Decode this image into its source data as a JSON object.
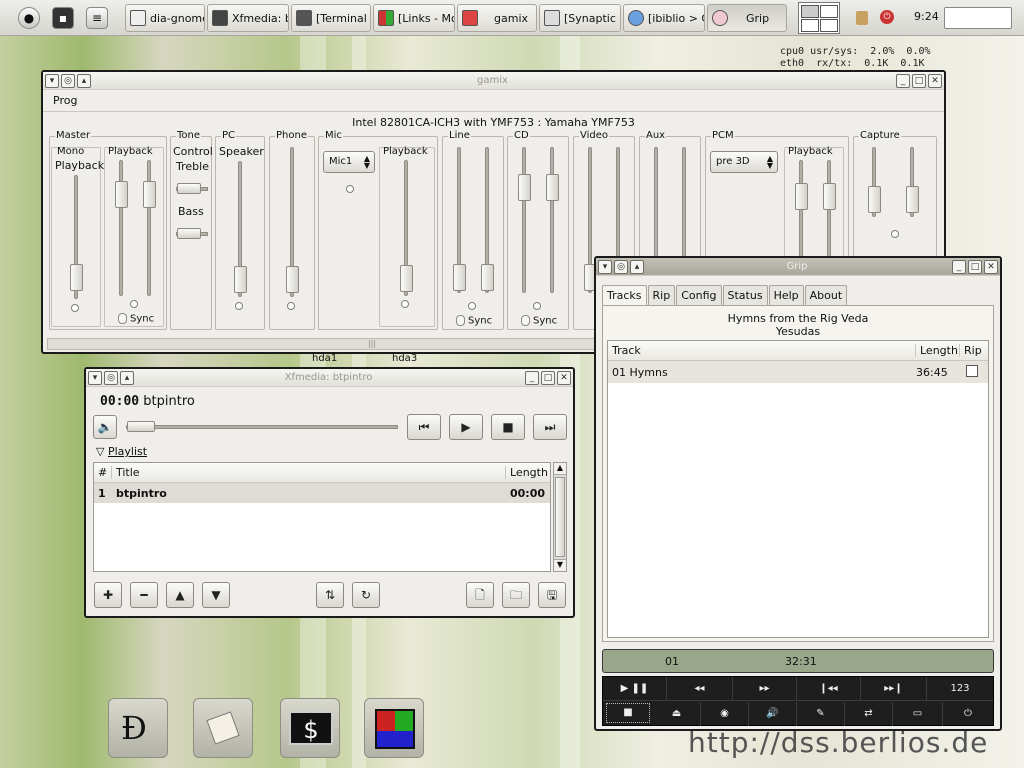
{
  "taskbar": {
    "tasks": [
      "dia-gnome (",
      "Xfmedia: btp",
      "[Terminal - d",
      "[Links - Mon",
      "gamix",
      "[Synaptic Pa",
      "[ibiblio > Co",
      "Grip"
    ],
    "clock": "9:24"
  },
  "sysmon": {
    "line1": "cpu0 usr/sys:  2.0%  0.0%",
    "line2": "eth0  rx/tx:  0.1K  0.1K"
  },
  "desktop_labels": [
    "hda1",
    "hda3"
  ],
  "watermark": "http://dss.berlios.de",
  "gamix": {
    "title": "gamix",
    "menu": "Prog",
    "card": "Intel 82801CA-ICH3 with YMF753 : Yamaha YMF753",
    "groups": {
      "master": "Master",
      "mono": "Mono",
      "mono_play": "Playback",
      "playback": "Playback",
      "sync": "Sync",
      "tone": "Tone",
      "control": "Control",
      "treble": "Treble",
      "bass": "Bass",
      "pc": "PC",
      "speaker": "Speaker",
      "phone": "Phone",
      "mic": "Mic",
      "mic_combo": "Mic1",
      "line": "Line",
      "cd": "CD",
      "video": "Video",
      "aux": "Aux",
      "pcm": "PCM",
      "pcm_combo": "pre 3D",
      "capture": "Capture"
    }
  },
  "xfmedia": {
    "title": "Xfmedia: btpintro",
    "time": "00:00",
    "track": "btpintro",
    "playlist_label": "Playlist",
    "columns": {
      "num": "#",
      "title": "Title",
      "length": "Length"
    },
    "rows": [
      {
        "num": "1",
        "title": "btpintro",
        "length": "00:00"
      }
    ]
  },
  "grip": {
    "title": "Grip",
    "tabs": [
      "Tracks",
      "Rip",
      "Config",
      "Status",
      "Help",
      "About"
    ],
    "album": "Hymns from the Rig Veda",
    "artist": "Yesudas",
    "columns": {
      "track": "Track",
      "length": "Length",
      "rip": "Rip"
    },
    "rows": [
      {
        "track": "01  Hymns",
        "length": "36:45",
        "rip": false
      }
    ],
    "status": {
      "track": "01",
      "time": "32:31"
    },
    "controls_row1": [
      "▶ ❚❚",
      "◂◂",
      "▸▸",
      "❙◂◂",
      "▸▸❙",
      "123"
    ],
    "controls_row2": [
      "■",
      "⏏",
      "◉",
      "🔊",
      "✎",
      "⇄",
      "▭",
      "⏻"
    ]
  },
  "dock": [
    "dia",
    "editor",
    "terminal",
    "xfce"
  ]
}
